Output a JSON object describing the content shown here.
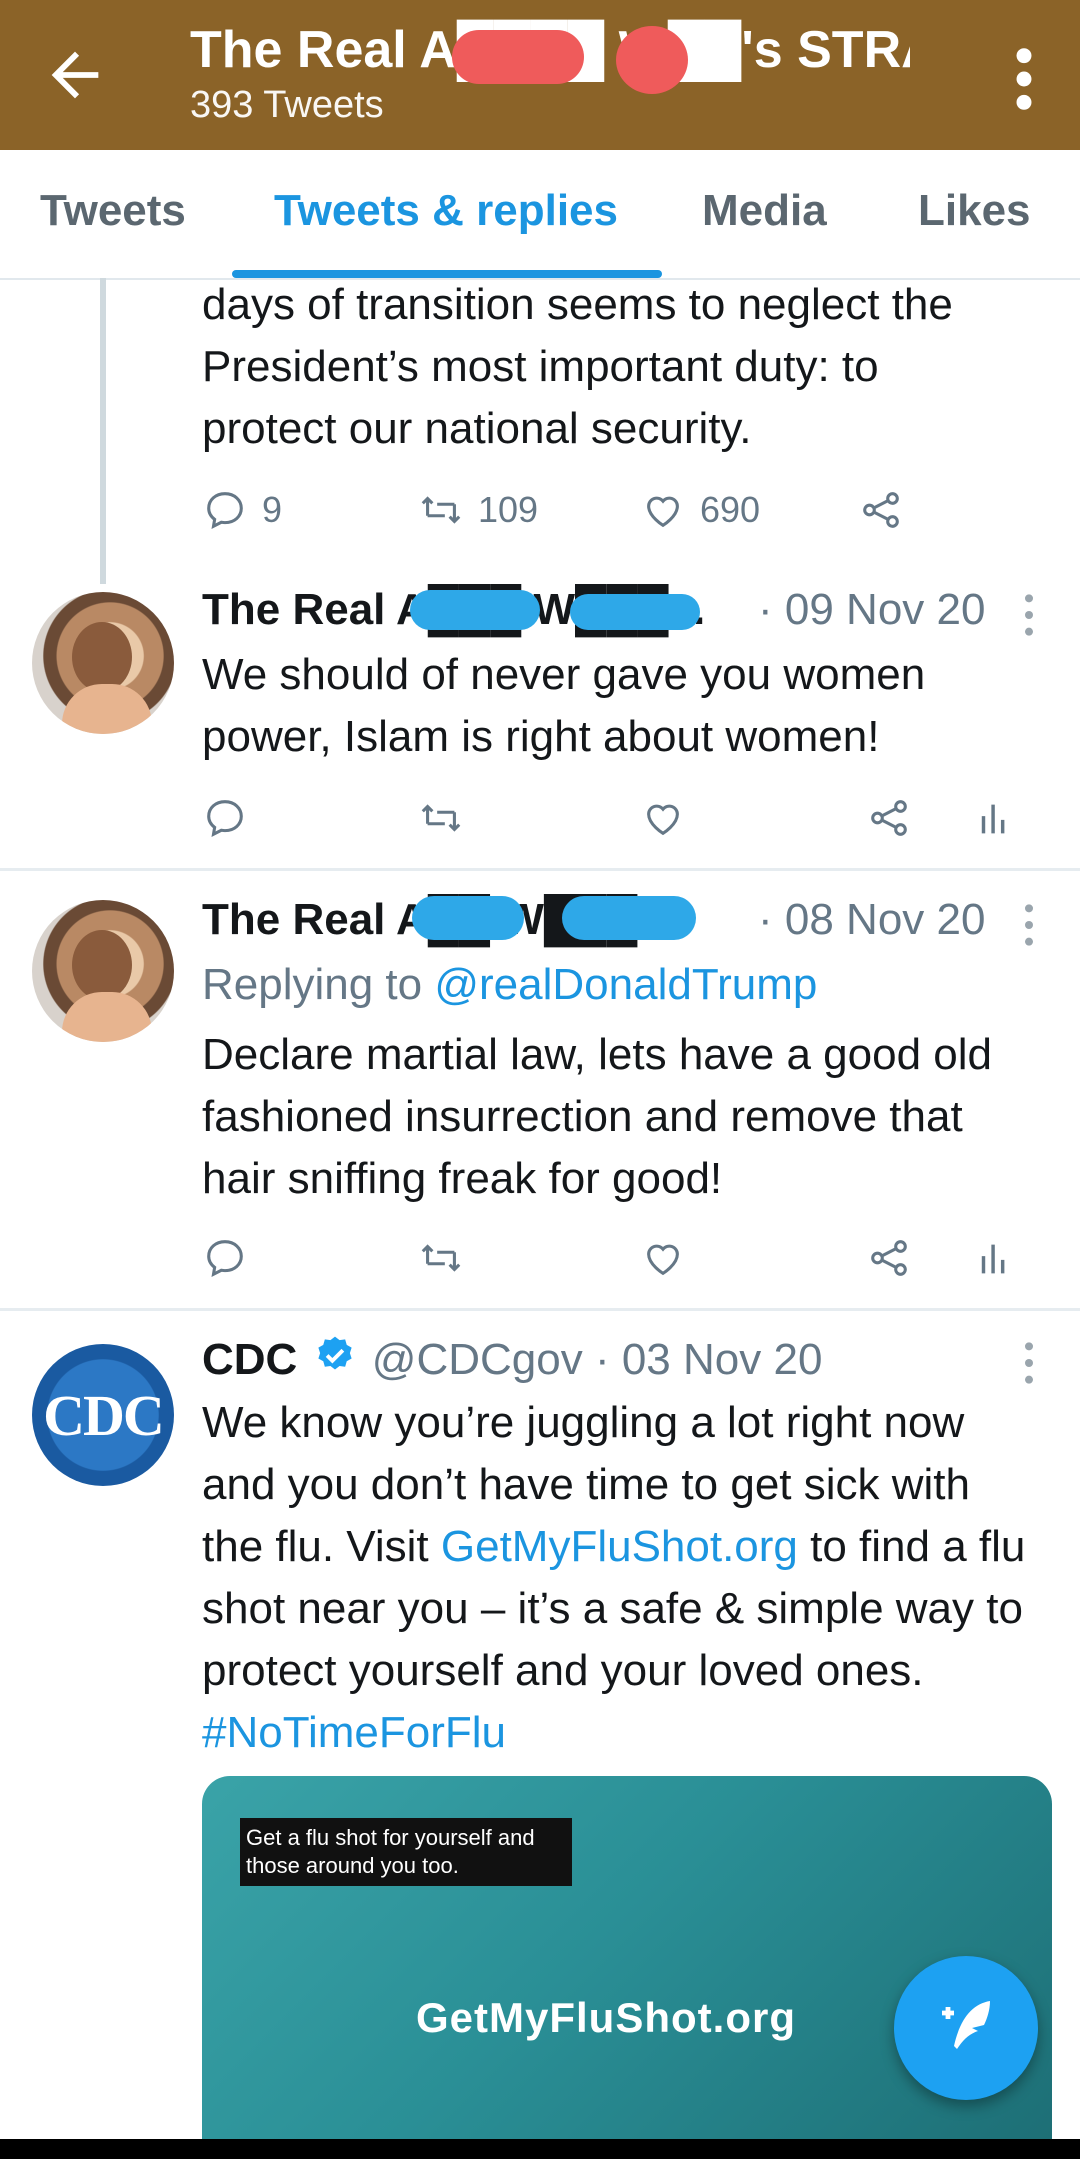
{
  "appbar": {
    "title": "The Real A████ W██'s STRA...",
    "subtitle": "393 Tweets"
  },
  "tabs": [
    {
      "label": "Tweets",
      "active": false
    },
    {
      "label": "Tweets & replies",
      "active": true
    },
    {
      "label": "Media",
      "active": false
    },
    {
      "label": "Likes",
      "active": false
    }
  ],
  "tweets": [
    {
      "text_lines": [
        "days of transition seems to neglect the",
        "President’s most important duty: to",
        "protect our national security."
      ],
      "reply_count": "9",
      "retweet_count": "109",
      "like_count": "690"
    },
    {
      "name": "The Real A███ W███...",
      "meta": "· 09 Nov 20",
      "text_lines": [
        "We should of never gave you women",
        "power, Islam is right about women!"
      ]
    },
    {
      "name": "The Real A██ W███...",
      "meta": "· 08 Nov 20",
      "reply_prefix": "Replying to ",
      "reply_handle": "@realDonaldTrump",
      "text_lines": [
        "Declare martial law, lets have a good old",
        "fashioned insurrection and remove that",
        "hair sniffing freak for good!"
      ]
    },
    {
      "name": "CDC",
      "handle_date": "@CDCgov · 03 Nov 20",
      "avatar_text": "CDC",
      "line1": "We know you’re juggling a lot right now",
      "line2": "and you don’t have time to get sick with",
      "line3_pre": "the flu. Visit ",
      "line3_link": "GetMyFluShot.org",
      "line3_post": " to find a flu",
      "line4": "shot near you – it’s a safe & simple way to",
      "line5": "protect yourself and your loved ones.",
      "hashtag": "#NoTimeForFlu",
      "media_caption": "Get a flu shot for yourself and those around you too.",
      "media_url": "GetMyFluShot.org"
    }
  ],
  "colors": {
    "appbar": "#8b6328",
    "accent": "#1b95e0",
    "muted": "#657786"
  }
}
